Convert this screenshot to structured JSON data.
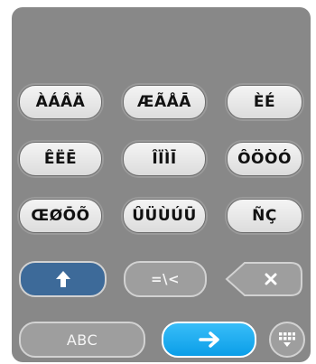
{
  "keyboard": {
    "rows": [
      [
        "ÀÁÂÄ",
        "ÆÃÅĀ",
        "ÈÉ"
      ],
      [
        "ÊËĒ",
        "ÎÏÌĪ",
        "ÔÖÒÓ"
      ],
      [
        "ŒØŌÕ",
        "ÛÜÙÚŪ",
        "ÑÇ"
      ]
    ],
    "shift_icon": "up-arrow-icon",
    "symbols_key": "=\\<",
    "delete_icon": "x-icon",
    "abc_label": "ABC",
    "enter_icon": "right-arrow-icon",
    "hide_keyboard_icon": "keyboard-grid-icon"
  }
}
